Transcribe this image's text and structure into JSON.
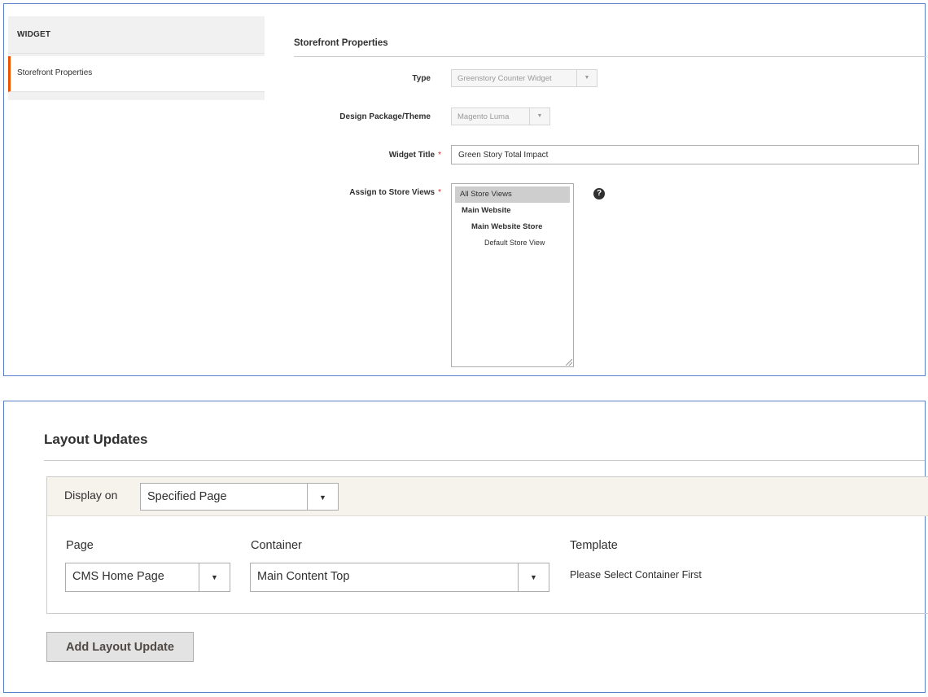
{
  "sidebar": {
    "title": "WIDGET",
    "items": [
      {
        "label": "Storefront Properties",
        "active": true
      }
    ]
  },
  "storefront": {
    "section_title": "Storefront Properties",
    "type": {
      "label": "Type",
      "value": "Greenstory Counter Widget"
    },
    "theme": {
      "label": "Design Package/Theme",
      "value": "Magento Luma"
    },
    "widget_title": {
      "label": "Widget Title",
      "value": "Green Story Total Impact",
      "required_mark": "*"
    },
    "store_views": {
      "label": "Assign to Store Views",
      "required_mark": "*",
      "options": [
        {
          "text": "All Store Views",
          "selected": true
        },
        {
          "text": "Main Website"
        },
        {
          "text": "Main Website Store"
        },
        {
          "text": "Default Store View"
        }
      ],
      "help_icon": "?"
    }
  },
  "layout_updates": {
    "title": "Layout Updates",
    "display_on": {
      "label": "Display on",
      "value": "Specified Page"
    },
    "page": {
      "label": "Page",
      "value": "CMS Home Page"
    },
    "container": {
      "label": "Container",
      "value": "Main Content Top"
    },
    "template": {
      "label": "Template",
      "value": "Please Select Container First"
    },
    "add_button": "Add Layout Update"
  },
  "colors": {
    "accent": "#eb5202",
    "required": "#e22626",
    "panel_border": "#5b7fc7",
    "header_bg": "#f6f2ec"
  },
  "icons": {
    "dropdown": "chevron-down-icon",
    "help": "help-icon"
  }
}
